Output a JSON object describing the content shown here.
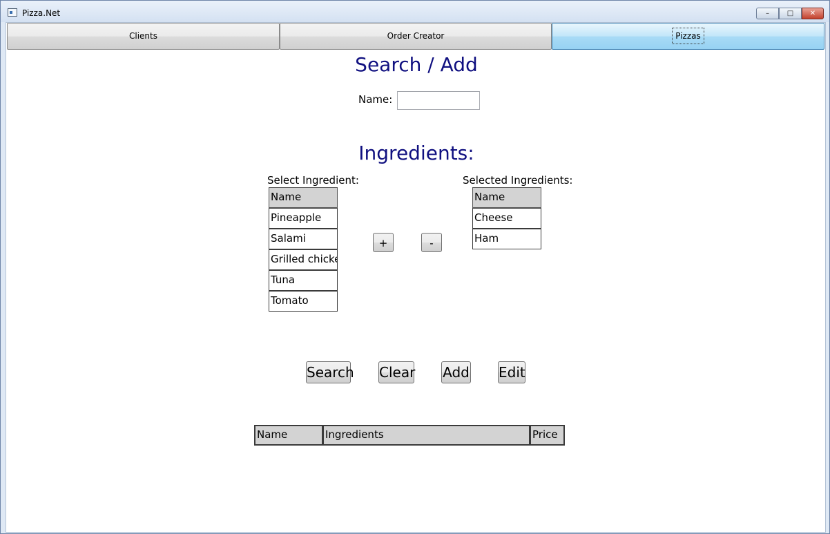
{
  "window": {
    "title": "Pizza.Net",
    "controls": {
      "minimize": "–",
      "maximize": "□",
      "close": "✕"
    }
  },
  "tabs": [
    {
      "label": "Clients"
    },
    {
      "label": "Order Creator"
    },
    {
      "label": "Pizzas",
      "selected": true
    }
  ],
  "search_section": {
    "heading": "Search / Add",
    "name_label": "Name:",
    "name_value": ""
  },
  "ingredients_section": {
    "heading": "Ingredients:",
    "select_label": "Select Ingredient:",
    "selected_label": "Selected Ingredients:",
    "column_header": "Name",
    "available": [
      "Pineapple",
      "Salami",
      "Grilled chicken",
      "Tuna",
      "Tomato"
    ],
    "selected": [
      "Cheese",
      "Ham"
    ],
    "add_button": "+",
    "remove_button": "-"
  },
  "actions": {
    "search": "Search",
    "clear": "Clear",
    "add": "Add",
    "edit": "Edit"
  },
  "results_grid": {
    "columns": [
      "Name",
      "Ingredients",
      "Price"
    ]
  }
}
